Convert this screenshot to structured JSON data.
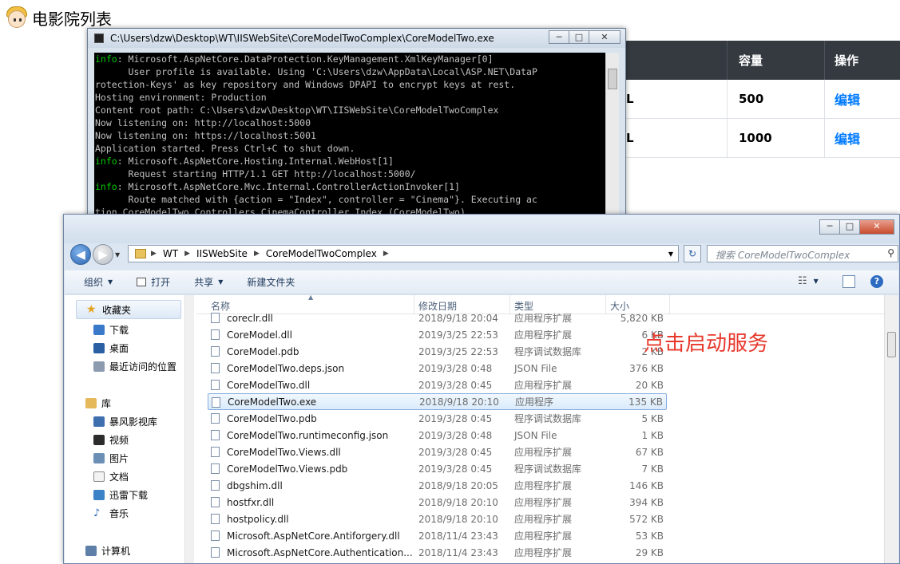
{
  "web": {
    "title": "电影院列表",
    "table": {
      "headers": [
        "",
        "容量",
        "操作"
      ],
      "rows": [
        {
          "partial": "L",
          "capacity": "500",
          "action": "编辑"
        },
        {
          "partial": "L",
          "capacity": "1000",
          "action": "编辑"
        }
      ]
    }
  },
  "console": {
    "title": "C:\\Users\\dzw\\Desktop\\WT\\IISWebSite\\CoreModelTwoComplex\\CoreModelTwo.exe",
    "lines": [
      {
        "tag": "info",
        "text": ": Microsoft.AspNetCore.DataProtection.KeyManagement.XmlKeyManager[0]"
      },
      {
        "tag": "",
        "text": "      User profile is available. Using 'C:\\Users\\dzw\\AppData\\Local\\ASP.NET\\DataP"
      },
      {
        "tag": "",
        "text": "rotection-Keys' as key repository and Windows DPAPI to encrypt keys at rest."
      },
      {
        "tag": "",
        "text": "Hosting environment: Production"
      },
      {
        "tag": "",
        "text": "Content root path: C:\\Users\\dzw\\Desktop\\WT\\IISWebSite\\CoreModelTwoComplex"
      },
      {
        "tag": "",
        "text": "Now listening on: http://localhost:5000"
      },
      {
        "tag": "",
        "text": "Now listening on: https://localhost:5001"
      },
      {
        "tag": "",
        "text": "Application started. Press Ctrl+C to shut down."
      },
      {
        "tag": "info",
        "text": ": Microsoft.AspNetCore.Hosting.Internal.WebHost[1]"
      },
      {
        "tag": "",
        "text": "      Request starting HTTP/1.1 GET http://localhost:5000/"
      },
      {
        "tag": "info",
        "text": ": Microsoft.AspNetCore.Mvc.Internal.ControllerActionInvoker[1]"
      },
      {
        "tag": "",
        "text": "      Route matched with {action = \"Index\", controller = \"Cinema\"}. Executing ac"
      },
      {
        "tag": "",
        "text": "tion CoreModelTwo.Controllers.CinemaController.Index (CoreModelTwo)"
      }
    ]
  },
  "explorer": {
    "breadcrumbs": [
      "WT",
      "IISWebSite",
      "CoreModelTwoComplex"
    ],
    "search_placeholder": "搜索 CoreModelTwoComplex",
    "toolbar": {
      "organize": "组织",
      "open": "打开",
      "share": "共享",
      "new_folder": "新建文件夹"
    },
    "nav": {
      "favorites": "收藏夹",
      "fav_items": [
        "下载",
        "桌面",
        "最近访问的位置"
      ],
      "libraries": "库",
      "lib_items": [
        "暴风影视库",
        "视频",
        "图片",
        "文档",
        "迅雷下载",
        "音乐"
      ],
      "computer": "计算机"
    },
    "columns": {
      "name": "名称",
      "date": "修改日期",
      "type": "类型",
      "size": "大小"
    },
    "files": [
      {
        "name": "coreclr.dll",
        "date": "2018/9/18 20:04",
        "type": "应用程序扩展",
        "size": "5,820 KB",
        "selected": false
      },
      {
        "name": "CoreModel.dll",
        "date": "2019/3/25 22:53",
        "type": "应用程序扩展",
        "size": "6 KB",
        "selected": false
      },
      {
        "name": "CoreModel.pdb",
        "date": "2019/3/25 22:53",
        "type": "程序调试数据库",
        "size": "2 KB",
        "selected": false
      },
      {
        "name": "CoreModelTwo.deps.json",
        "date": "2019/3/28 0:48",
        "type": "JSON File",
        "size": "376 KB",
        "selected": false
      },
      {
        "name": "CoreModelTwo.dll",
        "date": "2019/3/28 0:45",
        "type": "应用程序扩展",
        "size": "20 KB",
        "selected": false
      },
      {
        "name": "CoreModelTwo.exe",
        "date": "2018/9/18 20:10",
        "type": "应用程序",
        "size": "135 KB",
        "selected": true
      },
      {
        "name": "CoreModelTwo.pdb",
        "date": "2019/3/28 0:45",
        "type": "程序调试数据库",
        "size": "5 KB",
        "selected": false
      },
      {
        "name": "CoreModelTwo.runtimeconfig.json",
        "date": "2019/3/28 0:48",
        "type": "JSON File",
        "size": "1 KB",
        "selected": false
      },
      {
        "name": "CoreModelTwo.Views.dll",
        "date": "2019/3/28 0:45",
        "type": "应用程序扩展",
        "size": "67 KB",
        "selected": false
      },
      {
        "name": "CoreModelTwo.Views.pdb",
        "date": "2019/3/28 0:45",
        "type": "程序调试数据库",
        "size": "7 KB",
        "selected": false
      },
      {
        "name": "dbgshim.dll",
        "date": "2018/9/18 20:05",
        "type": "应用程序扩展",
        "size": "146 KB",
        "selected": false
      },
      {
        "name": "hostfxr.dll",
        "date": "2018/9/18 20:10",
        "type": "应用程序扩展",
        "size": "394 KB",
        "selected": false
      },
      {
        "name": "hostpolicy.dll",
        "date": "2018/9/18 20:10",
        "type": "应用程序扩展",
        "size": "572 KB",
        "selected": false
      },
      {
        "name": "Microsoft.AspNetCore.Antiforgery.dll",
        "date": "2018/11/4 23:43",
        "type": "应用程序扩展",
        "size": "53 KB",
        "selected": false
      },
      {
        "name": "Microsoft.AspNetCore.Authentication...",
        "date": "2018/11/4 23:43",
        "type": "应用程序扩展",
        "size": "29 KB",
        "selected": false
      }
    ],
    "hint": "点击启动服务"
  }
}
